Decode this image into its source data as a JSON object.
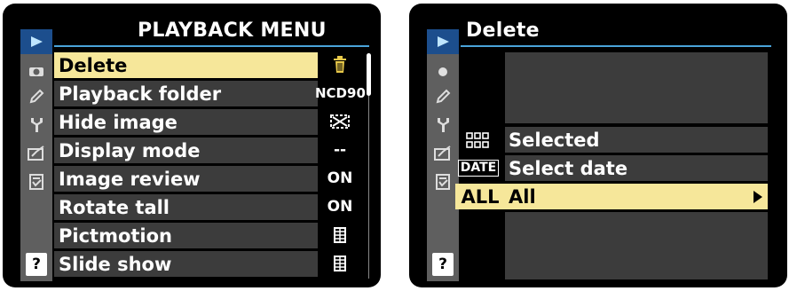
{
  "left_screen": {
    "title": "PLAYBACK MENU",
    "tabs": [
      {
        "icon": "playback-icon"
      },
      {
        "icon": "camera-icon"
      },
      {
        "icon": "pencil-icon"
      },
      {
        "icon": "wrench-icon"
      },
      {
        "icon": "retouch-icon"
      },
      {
        "icon": "recent-settings-icon"
      },
      {
        "icon": "help-icon",
        "glyph": "?"
      }
    ],
    "items": [
      {
        "label": "Delete",
        "value_icon": "trash-icon"
      },
      {
        "label": "Playback folder",
        "value": "NCD90"
      },
      {
        "label": "Hide image",
        "value_icon": "hide-image-icon"
      },
      {
        "label": "Display mode",
        "value": "--"
      },
      {
        "label": "Image review",
        "value": "ON"
      },
      {
        "label": "Rotate tall",
        "value": "ON"
      },
      {
        "label": "Pictmotion",
        "value_icon": "pictmotion-icon"
      },
      {
        "label": "Slide show",
        "value_icon": "slideshow-icon"
      }
    ],
    "selected_index": 0
  },
  "right_screen": {
    "title": "Delete",
    "tabs": [
      {
        "icon": "playback-icon"
      },
      {
        "icon": "camera-icon"
      },
      {
        "icon": "pencil-icon"
      },
      {
        "icon": "wrench-icon"
      },
      {
        "icon": "retouch-icon"
      },
      {
        "icon": "recent-settings-icon"
      },
      {
        "icon": "help-icon",
        "glyph": "?"
      }
    ],
    "options": [
      {
        "icon_text": "",
        "icon": "grid-icon",
        "label": "Selected"
      },
      {
        "icon_text": "DATE",
        "icon": "date-icon",
        "label": "Select date"
      },
      {
        "icon_text": "ALL",
        "icon": "all-icon",
        "label": "All"
      }
    ],
    "selected_index": 2
  },
  "colors": {
    "highlight": "#f6e79a",
    "row_bg": "#3c3c3c",
    "tab_strip": "#5f5f5f",
    "active_tab": "#1c4e8d",
    "title_rule": "#4aa3d9"
  }
}
